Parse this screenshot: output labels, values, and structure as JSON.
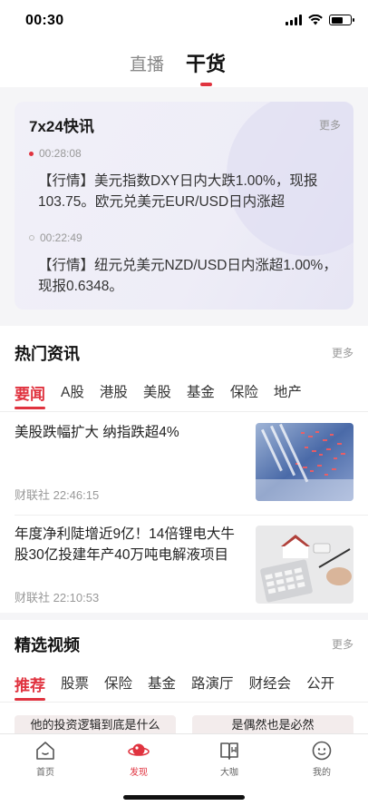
{
  "status": {
    "time": "00:30",
    "battery_level": 0.6
  },
  "top_tabs": [
    {
      "label": "直播"
    },
    {
      "label": "干货"
    }
  ],
  "flash": {
    "title": "7x24快讯",
    "more": "更多",
    "items": [
      {
        "time": "00:28:08",
        "text": "【行情】美元指数DXY日内大跌1.00%，现报103.75。欧元兑美元EUR/USD日内涨超"
      },
      {
        "time": "00:22:49",
        "text": "【行情】纽元兑美元NZD/USD日内涨超1.00%，现报0.6348。"
      }
    ]
  },
  "hot": {
    "title": "热门资讯",
    "more": "更多",
    "tabs": [
      "要闻",
      "A股",
      "港股",
      "美股",
      "基金",
      "保险",
      "地产"
    ],
    "articles": [
      {
        "title": "美股跌幅扩大 纳指跌超4%",
        "source": "财联社 22:46:15"
      },
      {
        "title": "年度净利陡增近9亿！14倍锂电大牛股30亿投建年产40万吨电解液项目",
        "source": "财联社 22:10:53"
      }
    ]
  },
  "video": {
    "title": "精选视频",
    "more": "更多",
    "tabs": [
      "推荐",
      "股票",
      "保险",
      "基金",
      "路演厅",
      "财经会",
      "公开"
    ],
    "cards": [
      "他的投资逻辑到底是什么",
      "是偶然也是必然"
    ]
  },
  "tab_bar": [
    {
      "label": "首页",
      "icon": "home-icon"
    },
    {
      "label": "发现",
      "icon": "discover-icon"
    },
    {
      "label": "大咖",
      "icon": "book-icon"
    },
    {
      "label": "我的",
      "icon": "profile-icon"
    }
  ],
  "colors": {
    "accent": "#e0333f"
  }
}
